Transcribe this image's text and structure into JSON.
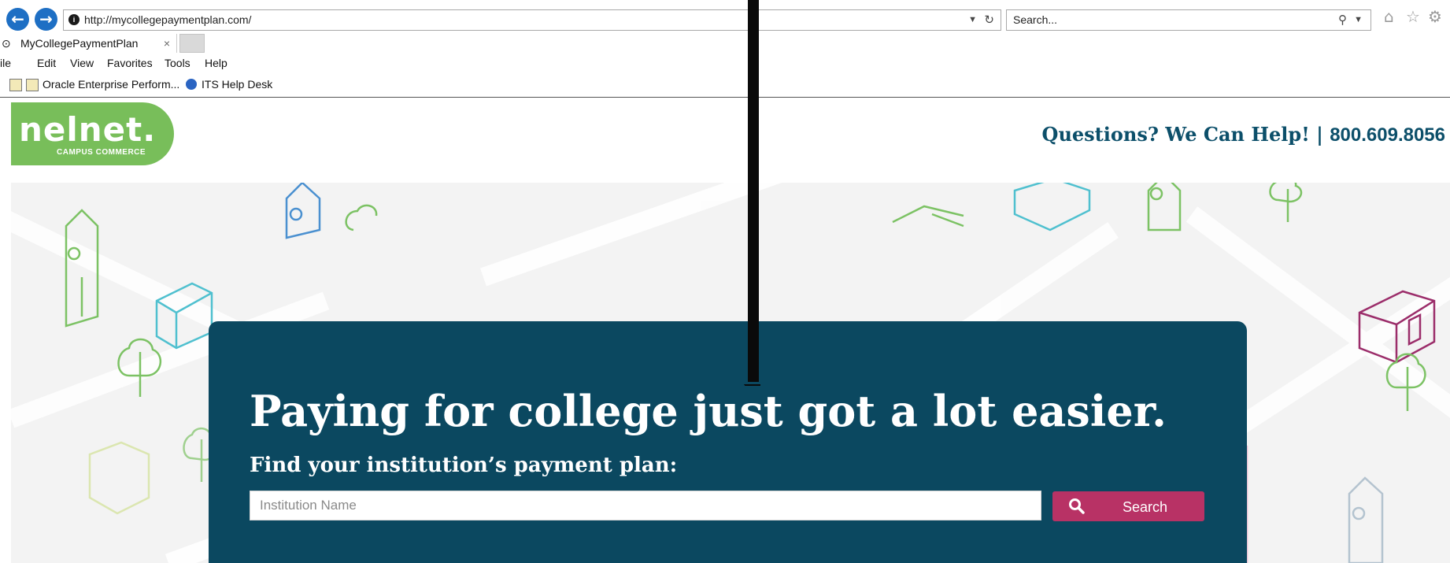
{
  "browser": {
    "url": "http://mycollegepaymentplan.com/",
    "search_placeholder": "Search...",
    "tab_title": "MyCollegePaymentPlan",
    "tab_close": "×",
    "menu": [
      "ile",
      "Edit",
      "View",
      "Favorites",
      "Tools",
      "Help"
    ],
    "favorites": [
      "Oracle Enterprise Perform...",
      "ITS Help Desk"
    ]
  },
  "header": {
    "logo_word": "nelnet.",
    "logo_sub": "CAMPUS COMMERCE",
    "help_text": "Questions? We Can Help!",
    "separator": "|",
    "phone": "800.609.8056"
  },
  "hero": {
    "headline": "Paying for college just got a lot easier.",
    "subhead": "Find your institution’s payment plan:",
    "input_placeholder": "Institution Name",
    "search_label": "Search"
  },
  "colors": {
    "brand_green": "#78be5a",
    "card_bg": "#0b4860",
    "button_bg": "#b83265",
    "header_text": "#0c4f6a"
  }
}
